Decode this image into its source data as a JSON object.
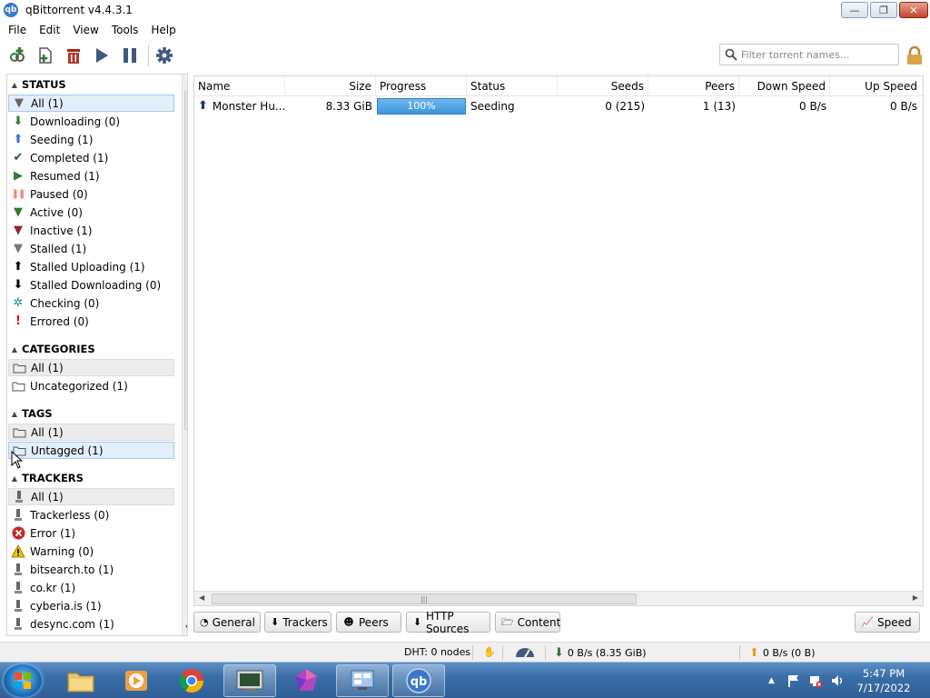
{
  "window": {
    "title": "qBittorrent v4.4.3.1",
    "app_icon": "qb",
    "min_glyph": "—",
    "max_glyph": "❐",
    "close_glyph": "✕"
  },
  "menu": [
    "File",
    "Edit",
    "View",
    "Tools",
    "Help"
  ],
  "toolbar": {
    "filter_placeholder": "Filter torrent names..."
  },
  "sidebar": {
    "status": {
      "header": "STATUS",
      "items": [
        {
          "label": "All (1)",
          "icon": "filter-icon",
          "glyph": "▼",
          "color": "#666666"
        },
        {
          "label": "Downloading (0)",
          "icon": "download-arrow-icon",
          "glyph": "⬇",
          "color": "#2e7d32"
        },
        {
          "label": "Seeding (1)",
          "icon": "upload-arrow-icon",
          "glyph": "⬆",
          "color": "#2f6fd6"
        },
        {
          "label": "Completed (1)",
          "icon": "checkmark-icon",
          "glyph": "✔",
          "color": "#2e5a2e"
        },
        {
          "label": "Resumed (1)",
          "icon": "play-icon",
          "glyph": "▶",
          "color": "#2e7d32"
        },
        {
          "label": "Paused (0)",
          "icon": "pause-icon",
          "glyph": "❚❚",
          "color": "#f08a80"
        },
        {
          "label": "Active (0)",
          "icon": "filter-icon",
          "glyph": "▼",
          "color": "#2e7d32"
        },
        {
          "label": "Inactive (1)",
          "icon": "filter-icon",
          "glyph": "▼",
          "color": "#8b2a2a"
        },
        {
          "label": "Stalled (1)",
          "icon": "filter-icon",
          "glyph": "▼",
          "color": "#777777"
        },
        {
          "label": "Stalled Uploading (1)",
          "icon": "up-arrow-icon",
          "glyph": "⬆",
          "color": "#000000"
        },
        {
          "label": "Stalled Downloading (0)",
          "icon": "down-arrow-icon",
          "glyph": "⬇",
          "color": "#000000"
        },
        {
          "label": "Checking (0)",
          "icon": "gear-icon",
          "glyph": "✲",
          "color": "#1b8c8c"
        },
        {
          "label": "Errored (0)",
          "icon": "exclamation-icon",
          "glyph": "!",
          "color": "#d01010"
        }
      ]
    },
    "categories": {
      "header": "CATEGORIES",
      "items": [
        {
          "label": "All (1)",
          "icon": "folder-icon"
        },
        {
          "label": "Uncategorized (1)",
          "icon": "folder-icon"
        }
      ]
    },
    "tags": {
      "header": "TAGS",
      "items": [
        {
          "label": "All (1)",
          "icon": "folder-icon"
        },
        {
          "label": "Untagged (1)",
          "icon": "folder-icon"
        }
      ]
    },
    "trackers": {
      "header": "TRACKERS",
      "items": [
        {
          "label": "All (1)",
          "icon": "tracker-icon",
          "glyph": "⬇",
          "color": "#555555"
        },
        {
          "label": "Trackerless (0)",
          "icon": "tracker-icon",
          "glyph": "⬇",
          "color": "#555555"
        },
        {
          "label": "Error (1)",
          "icon": "error-icon",
          "glyph": "✕",
          "color": "#c62828"
        },
        {
          "label": "Warning (0)",
          "icon": "warning-icon",
          "glyph": "⚠",
          "color": "#e0a800"
        },
        {
          "label": "bitsearch.to (1)",
          "icon": "tracker-icon",
          "glyph": "⬇",
          "color": "#555555"
        },
        {
          "label": "co.kr (1)",
          "icon": "tracker-icon",
          "glyph": "⬇",
          "color": "#555555"
        },
        {
          "label": "cyberia.is (1)",
          "icon": "tracker-icon",
          "glyph": "⬇",
          "color": "#555555"
        },
        {
          "label": "desync.com (1)",
          "icon": "tracker-icon",
          "glyph": "⬇",
          "color": "#555555"
        }
      ]
    }
  },
  "transfer_list": {
    "columns": [
      "Name",
      "Size",
      "Progress",
      "Status",
      "Seeds",
      "Peers",
      "Down Speed",
      "Up Speed"
    ],
    "rows": [
      {
        "name": "Monster Hu...",
        "size": "8.33 GiB",
        "progress": "100%",
        "progress_fraction": 1.0,
        "status": "Seeding",
        "seeds": "0 (215)",
        "peers": "1 (13)",
        "down_speed": "0 B/s",
        "up_speed": "0 B/s"
      }
    ]
  },
  "detail_tabs": [
    "General",
    "Trackers",
    "Peers",
    "HTTP Sources",
    "Content"
  ],
  "speed_button": "Speed",
  "statusbar": {
    "dht": "DHT: 0 nodes",
    "download": "0 B/s (8.35 GiB)",
    "upload": "0 B/s (0 B)"
  },
  "taskbar": {
    "time": "5:47 PM",
    "date": "7/17/2022",
    "tray_arrow": "▲"
  },
  "colors": {
    "accent": "#3b95dd",
    "selection": "#e3eefb"
  }
}
